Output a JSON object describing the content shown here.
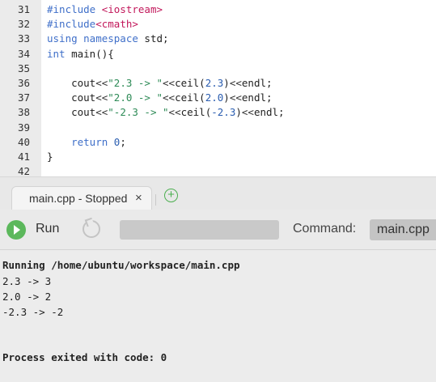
{
  "editor": {
    "lines": [
      {
        "num": "31",
        "tokens": [
          {
            "t": "#include ",
            "c": "kw"
          },
          {
            "t": "<iostream>",
            "c": "inc"
          }
        ]
      },
      {
        "num": "32",
        "tokens": [
          {
            "t": "#include",
            "c": "kw"
          },
          {
            "t": "<cmath>",
            "c": "inc"
          }
        ]
      },
      {
        "num": "33",
        "tokens": [
          {
            "t": "using namespace ",
            "c": "kw"
          },
          {
            "t": "std;",
            "c": "pl"
          }
        ]
      },
      {
        "num": "34",
        "tokens": [
          {
            "t": "int ",
            "c": "kw"
          },
          {
            "t": "main(){",
            "c": "pl"
          }
        ]
      },
      {
        "num": "35",
        "tokens": []
      },
      {
        "num": "36",
        "tokens": [
          {
            "t": "    cout",
            "c": "pl"
          },
          {
            "t": "<<",
            "c": "op"
          },
          {
            "t": "\"2.3 -> \"",
            "c": "str"
          },
          {
            "t": "<<",
            "c": "op"
          },
          {
            "t": "ceil(",
            "c": "pl"
          },
          {
            "t": "2.3",
            "c": "num"
          },
          {
            "t": ")",
            "c": "pl"
          },
          {
            "t": "<<",
            "c": "op"
          },
          {
            "t": "endl;",
            "c": "pl"
          }
        ]
      },
      {
        "num": "37",
        "tokens": [
          {
            "t": "    cout",
            "c": "pl"
          },
          {
            "t": "<<",
            "c": "op"
          },
          {
            "t": "\"2.0 -> \"",
            "c": "str"
          },
          {
            "t": "<<",
            "c": "op"
          },
          {
            "t": "ceil(",
            "c": "pl"
          },
          {
            "t": "2.0",
            "c": "num"
          },
          {
            "t": ")",
            "c": "pl"
          },
          {
            "t": "<<",
            "c": "op"
          },
          {
            "t": "endl;",
            "c": "pl"
          }
        ]
      },
      {
        "num": "38",
        "tokens": [
          {
            "t": "    cout",
            "c": "pl"
          },
          {
            "t": "<<",
            "c": "op"
          },
          {
            "t": "\"-2.3 -> \"",
            "c": "str"
          },
          {
            "t": "<<",
            "c": "op"
          },
          {
            "t": "ceil(",
            "c": "pl"
          },
          {
            "t": "-2.3",
            "c": "num"
          },
          {
            "t": ")",
            "c": "pl"
          },
          {
            "t": "<<",
            "c": "op"
          },
          {
            "t": "endl;",
            "c": "pl"
          }
        ]
      },
      {
        "num": "39",
        "tokens": []
      },
      {
        "num": "40",
        "tokens": [
          {
            "t": "    return ",
            "c": "kw"
          },
          {
            "t": "0",
            "c": "num"
          },
          {
            "t": ";",
            "c": "pl"
          }
        ]
      },
      {
        "num": "41",
        "tokens": [
          {
            "t": "}",
            "c": "pl"
          }
        ]
      },
      {
        "num": "42",
        "tokens": []
      }
    ]
  },
  "tabs": {
    "active_label": "main.cpp - Stopped",
    "close_glyph": "×",
    "add_glyph": "+"
  },
  "toolbar": {
    "run_label": "Run",
    "command_label": "Command:",
    "command_value": "main.cpp"
  },
  "console": {
    "running_line": "Running /home/ubuntu/workspace/main.cpp",
    "output": [
      "2.3 -> 3",
      "2.0 -> 2",
      "-2.3 -> -2"
    ],
    "exit_line": "Process exited with code: 0"
  },
  "colors": {
    "keyword": "#3f6fc9",
    "include": "#c2185b",
    "string": "#2e8b57",
    "run_green": "#5cb85c",
    "add_tab_green": "#4caf50"
  }
}
